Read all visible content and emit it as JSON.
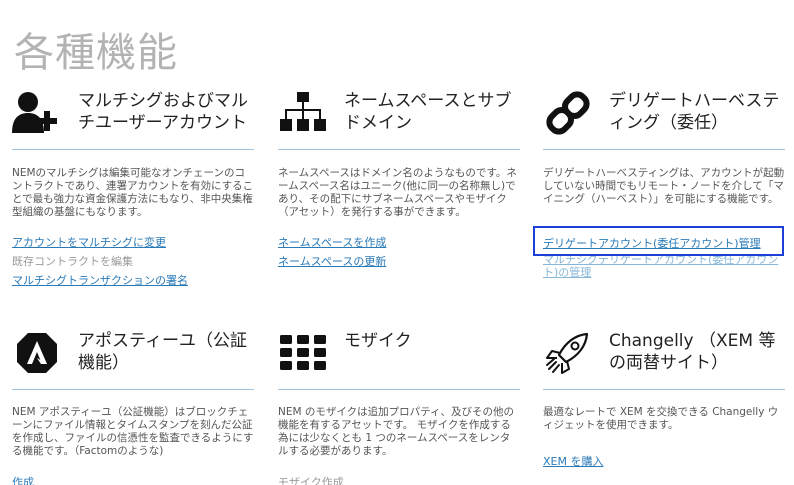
{
  "page_title": "各種機能",
  "cards": {
    "multisig": {
      "icon": "add-user-icon",
      "title": "マルチシグおよびマルチユーザーアカウント",
      "description": "NEMのマルチシグは編集可能なオンチェーンのコントラクトであり、連署アカウントを有効にすることで最も強力な資金保護方法にもなり、非中央集権型組織の基盤にもなります。",
      "links": [
        "アカウントをマルチシグに変更",
        "既存コントラクトを編集",
        "マルチシグトランザクションの署名"
      ]
    },
    "namespace": {
      "icon": "sitemap-icon",
      "title": "ネームスペースとサブドメイン",
      "description": "ネームスペースはドメイン名のようなものです。ネームスペース名はユニーク(他に同一の名称無し)であり、その配下にサブネームスペースやモザイク（アセット）を発行する事ができます。",
      "links": [
        "ネームスペースを作成",
        "ネームスペースの更新"
      ]
    },
    "delegated": {
      "icon": "chain-link-icon",
      "title": "デリゲートハーベスティング（委任）",
      "description": "デリゲートハーベスティングは、アカウントが起動していない時間でもリモート・ノードを介して「マイニング（ハーベスト）」を可能にする機能です。",
      "links": [
        "デリゲートアカウント(委任アカウント)管理",
        "マルチシグデリゲートアカウント(委任アカウント)の管理"
      ]
    },
    "apostille": {
      "icon": "apostille-logo-icon",
      "title": "アポスティーユ（公証機能）",
      "description": "NEM アポスティーユ（公証機能）はブロックチェーンにファイル情報とタイムスタンプを刻んだ公証を作成し、ファイルの信憑性を監査できるようにする機能です。（Factomのような)",
      "links": [
        "作成"
      ]
    },
    "mosaic": {
      "icon": "grid-icon",
      "title": "モザイク",
      "description": "NEM のモザイクは追加プロパティ、及びその他の機能を有するアセットです。 モザイクを作成する為には少なくとも 1 つのネームスペースをレンタルする必要があります。",
      "links": [
        "モザイク作成"
      ]
    },
    "changelly": {
      "icon": "rocket-icon",
      "title": "Changelly （XEM 等の両替サイト）",
      "description": "最適なレートで XEM を交換できる Changelly ウィジェットを使用できます。",
      "links": [
        "XEM を購入"
      ]
    }
  }
}
